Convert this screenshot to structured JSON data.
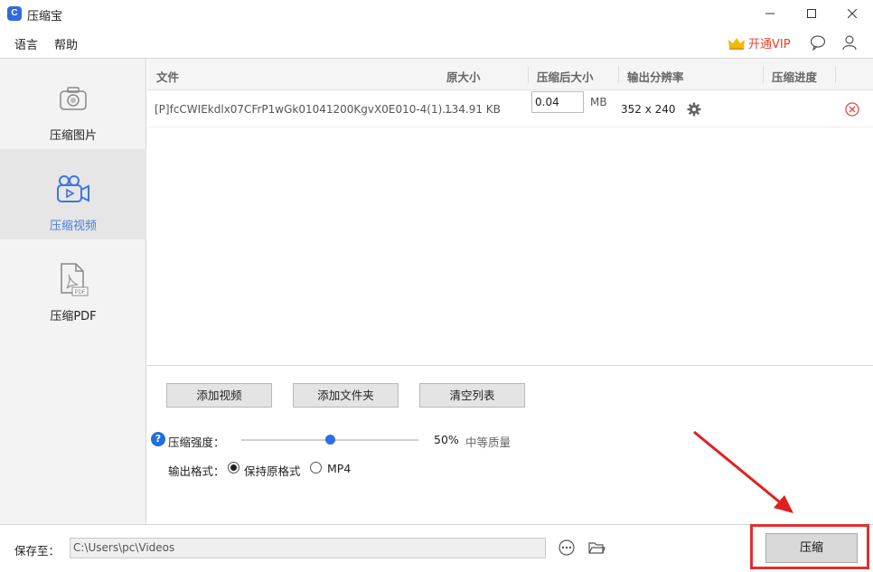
{
  "window": {
    "title": "压缩宝",
    "icon": "app-logo-icon"
  },
  "menu": {
    "language": "语言",
    "help": "帮助",
    "vip": "开通VIP"
  },
  "sidebar": {
    "items": [
      {
        "label": "压缩图片",
        "icon": "camera-icon"
      },
      {
        "label": "压缩视频",
        "icon": "video-camera-icon"
      },
      {
        "label": "压缩PDF",
        "icon": "pdf-file-icon"
      }
    ],
    "active_index": 1
  },
  "table": {
    "headers": {
      "file": "文件",
      "original_size": "原大小",
      "compressed_size": "压缩后大小",
      "resolution": "输出分辨率",
      "progress": "压缩进度"
    },
    "rows": [
      {
        "file": "[P]fcCWIEkdlx07CFrP1wGk01041200KgvX0E010-4(1)...",
        "original_size": "134.91 KB",
        "target_size": "0.04",
        "unit": "MB",
        "resolution": "352 x 240"
      }
    ]
  },
  "actions": {
    "add_video": "添加视频",
    "add_folder": "添加文件夹",
    "clear_list": "清空列表"
  },
  "settings": {
    "strength_label": "压缩强度：",
    "strength_percent": "50%",
    "strength_value": 0.5,
    "quality_label": "中等质量",
    "format_label": "输出格式：",
    "format_options": [
      "保持原格式",
      "MP4"
    ],
    "format_selected": "保持原格式"
  },
  "output": {
    "save_label": "保存至：",
    "save_path": "C:\\Users\\pc\\Videos",
    "compress_button": "压缩"
  },
  "colors": {
    "accent": "#2b6fe4",
    "active_text": "#4a7cd8",
    "vip": "#e9402c",
    "highlight": "#e03030"
  }
}
